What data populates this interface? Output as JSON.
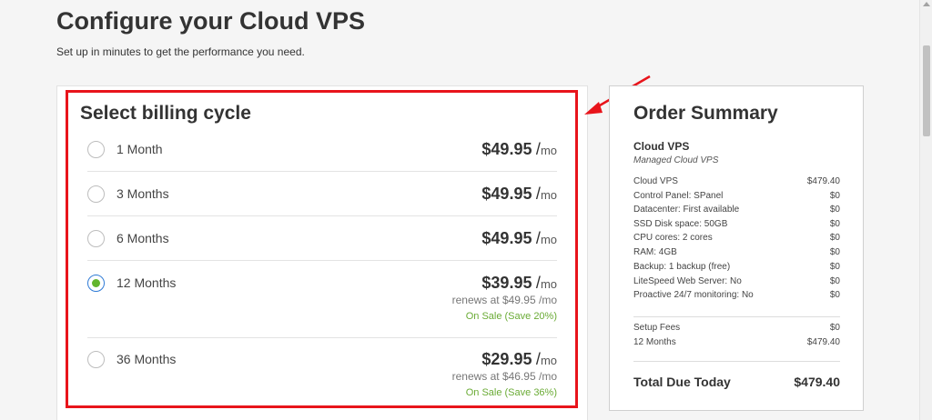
{
  "header": {
    "title": "Configure your Cloud VPS",
    "subtitle": "Set up in minutes to get the performance you need."
  },
  "billing": {
    "title": "Select billing cycle",
    "options": [
      {
        "label": "1 Month",
        "amount": "$49.95",
        "slash": "/",
        "unit": "mo",
        "selected": false,
        "renews": "",
        "sale": ""
      },
      {
        "label": "3 Months",
        "amount": "$49.95",
        "slash": "/",
        "unit": "mo",
        "selected": false,
        "renews": "",
        "sale": ""
      },
      {
        "label": "6 Months",
        "amount": "$49.95",
        "slash": "/",
        "unit": "mo",
        "selected": false,
        "renews": "",
        "sale": ""
      },
      {
        "label": "12 Months",
        "amount": "$39.95",
        "slash": "/",
        "unit": "mo",
        "selected": true,
        "renews": "renews at $49.95 /mo",
        "sale": "On Sale (Save 20%)"
      },
      {
        "label": "36 Months",
        "amount": "$29.95",
        "slash": "/",
        "unit": "mo",
        "selected": false,
        "renews": "renews at $46.95 /mo",
        "sale": "On Sale (Save 36%)"
      }
    ]
  },
  "summary": {
    "title": "Order Summary",
    "product_name": "Cloud VPS",
    "product_sub": "Managed Cloud VPS",
    "items": [
      {
        "label": "Cloud VPS",
        "value": "$479.40"
      },
      {
        "label": "Control Panel: SPanel",
        "value": "$0"
      },
      {
        "label": "Datacenter: First available",
        "value": "$0"
      },
      {
        "label": "SSD Disk space: 50GB",
        "value": "$0"
      },
      {
        "label": "CPU cores: 2 cores",
        "value": "$0"
      },
      {
        "label": "RAM: 4GB",
        "value": "$0"
      },
      {
        "label": "Backup: 1 backup (free)",
        "value": "$0"
      },
      {
        "label": "LiteSpeed Web Server: No",
        "value": "$0"
      },
      {
        "label": "Proactive 24/7 monitoring: No",
        "value": "$0"
      }
    ],
    "fees": [
      {
        "label": "Setup Fees",
        "value": "$0"
      },
      {
        "label": "12 Months",
        "value": "$479.40"
      }
    ],
    "total_label": "Total Due Today",
    "total_value": "$479.40"
  },
  "colors": {
    "highlight": "#e8141b",
    "radio_selected": "#63b52d",
    "sale_text": "#6aab35"
  },
  "icons": {
    "arrow": "red-arrow-icon"
  }
}
